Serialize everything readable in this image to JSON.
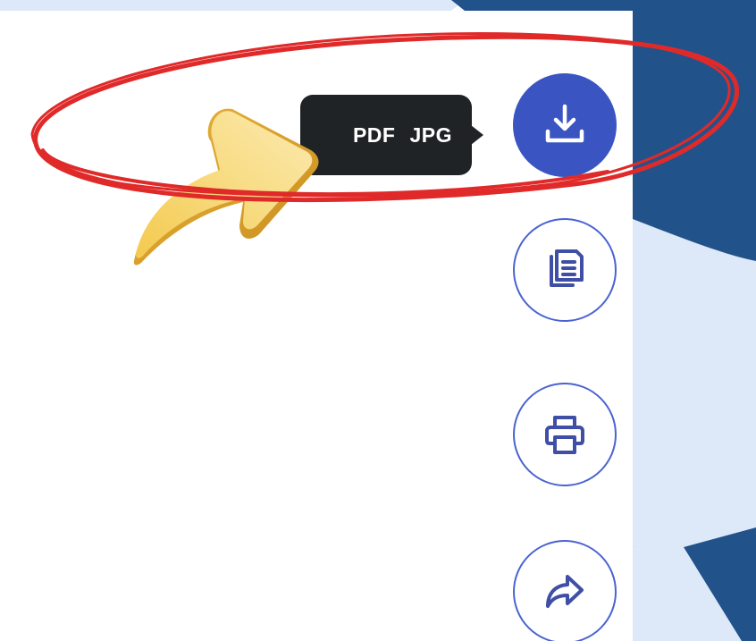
{
  "tooltip": {
    "pdf_label": "PDF",
    "jpg_label": "JPG"
  },
  "actions": [
    {
      "name": "download",
      "icon": "download-icon",
      "style": "filled"
    },
    {
      "name": "copy",
      "icon": "copy-document-icon",
      "style": "outline"
    },
    {
      "name": "print",
      "icon": "printer-icon",
      "style": "outline"
    },
    {
      "name": "share",
      "icon": "share-arrow-icon",
      "style": "outline"
    }
  ],
  "colors": {
    "accent": "#3a55c2",
    "outline": "#4a63d1",
    "tooltip_bg": "#202325",
    "background_navy": "#22528a",
    "background_light": "#dde9f8",
    "annotation_red": "#e02a2a",
    "arrow_yellow": "#f6d36a"
  },
  "decorations": {
    "highlight": "red-ellipse-annotation",
    "pointer": "yellow-3d-arrow-icon"
  }
}
